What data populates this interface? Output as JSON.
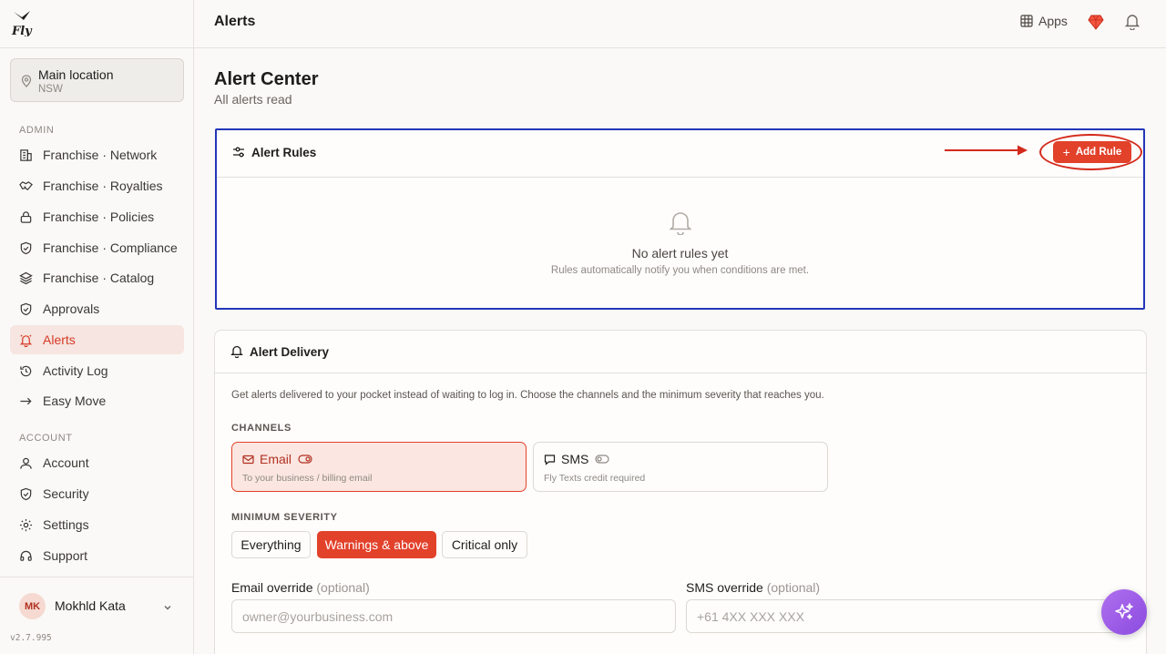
{
  "app": {
    "version": "v2.7.995",
    "logo_text": "fly"
  },
  "topbar": {
    "title": "Alerts",
    "apps_label": "Apps"
  },
  "sidebar": {
    "location": {
      "name": "Main location",
      "region": "NSW"
    },
    "admin_label": "ADMIN",
    "admin_items": [
      {
        "label": "Franchise · Network",
        "icon": "building-icon"
      },
      {
        "label": "Franchise · Royalties",
        "icon": "handshake-icon"
      },
      {
        "label": "Franchise · Policies",
        "icon": "lock-icon"
      },
      {
        "label": "Franchise · Compliance",
        "icon": "shield-icon"
      },
      {
        "label": "Franchise · Catalog",
        "icon": "layers-icon"
      },
      {
        "label": "Approvals",
        "icon": "shield-check-icon"
      },
      {
        "label": "Alerts",
        "icon": "bell-icon",
        "active": true
      },
      {
        "label": "Activity Log",
        "icon": "history-icon"
      },
      {
        "label": "Easy Move",
        "icon": "arrow-right-icon"
      }
    ],
    "account_label": "ACCOUNT",
    "account_items": [
      {
        "label": "Account",
        "icon": "user-icon"
      },
      {
        "label": "Security",
        "icon": "shield-icon"
      },
      {
        "label": "Settings",
        "icon": "gear-icon"
      },
      {
        "label": "Support",
        "icon": "headset-icon"
      }
    ],
    "user": {
      "initials": "MK",
      "name": "Mokhld Kata"
    }
  },
  "main": {
    "title": "Alert Center",
    "subtitle": "All alerts read",
    "rules": {
      "title": "Alert Rules",
      "add_label": "Add Rule",
      "empty_title": "No alert rules yet",
      "empty_sub": "Rules automatically notify you when conditions are met."
    },
    "delivery": {
      "title": "Alert Delivery",
      "description": "Get alerts delivered to your pocket instead of waiting to log in. Choose the channels and the minimum severity that reaches you.",
      "channels_label": "CHANNELS",
      "channels": [
        {
          "name": "Email",
          "sub": "To your business / billing email",
          "selected": true
        },
        {
          "name": "SMS",
          "sub": "Fly Texts credit required",
          "selected": false
        }
      ],
      "severity_label": "MINIMUM SEVERITY",
      "severities": [
        {
          "label": "Everything",
          "active": false
        },
        {
          "label": "Warnings & above",
          "active": true
        },
        {
          "label": "Critical only",
          "active": false
        }
      ],
      "email_override": {
        "label": "Email override",
        "optional": "(optional)",
        "placeholder": "owner@yourbusiness.com"
      },
      "sms_override": {
        "label": "SMS override",
        "optional": "(optional)",
        "placeholder": "+61 4XX XXX XXX"
      }
    }
  },
  "colors": {
    "accent": "#e2412a",
    "annotation_box": "#2436b8",
    "fab": "#9b5de5"
  }
}
